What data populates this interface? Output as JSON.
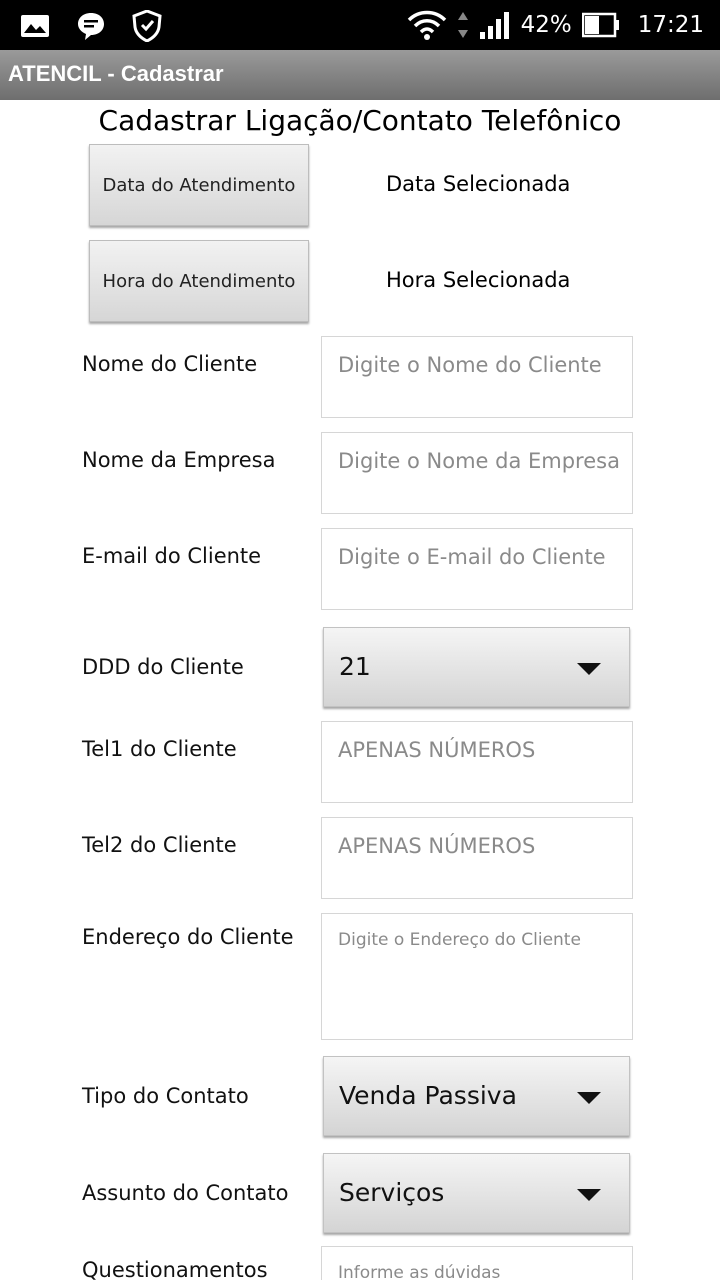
{
  "status_bar": {
    "icons": [
      "image-icon",
      "message-icon",
      "shield-icon",
      "wifi-icon",
      "data-arrows-icon",
      "signal-icon",
      "battery-icon"
    ],
    "battery": "42%",
    "time": "17:21"
  },
  "app": {
    "title": "ATENCIL - Cadastrar"
  },
  "form": {
    "heading": "Cadastrar Ligação/Contato Telefônico",
    "date_button": "Data do Atendimento",
    "date_selected": "Data Selecionada",
    "time_button": "Hora do Atendimento",
    "time_selected": "Hora Selecionada",
    "client_name": {
      "label": "Nome do Cliente",
      "placeholder": "Digite o Nome do Cliente"
    },
    "company_name": {
      "label": "Nome da Empresa",
      "placeholder": "Digite o Nome da Empresa"
    },
    "client_email": {
      "label": "E-mail do Cliente",
      "placeholder": "Digite o E-mail do Cliente"
    },
    "ddd": {
      "label": "DDD do Cliente",
      "value": "21"
    },
    "tel1": {
      "label": "Tel1 do Cliente",
      "placeholder": "APENAS NÚMEROS"
    },
    "tel2": {
      "label": "Tel2 do Cliente",
      "placeholder": "APENAS NÚMEROS"
    },
    "address": {
      "label": "Endereço do Cliente",
      "placeholder": "Digite o Endereço do Cliente"
    },
    "contact_type": {
      "label": "Tipo do Contato",
      "value": "Venda Passiva"
    },
    "contact_subject": {
      "label": "Assunto do Contato",
      "value": "Serviços"
    },
    "questions": {
      "label": "Questionamentos",
      "placeholder": "Informe as dúvidas"
    }
  }
}
